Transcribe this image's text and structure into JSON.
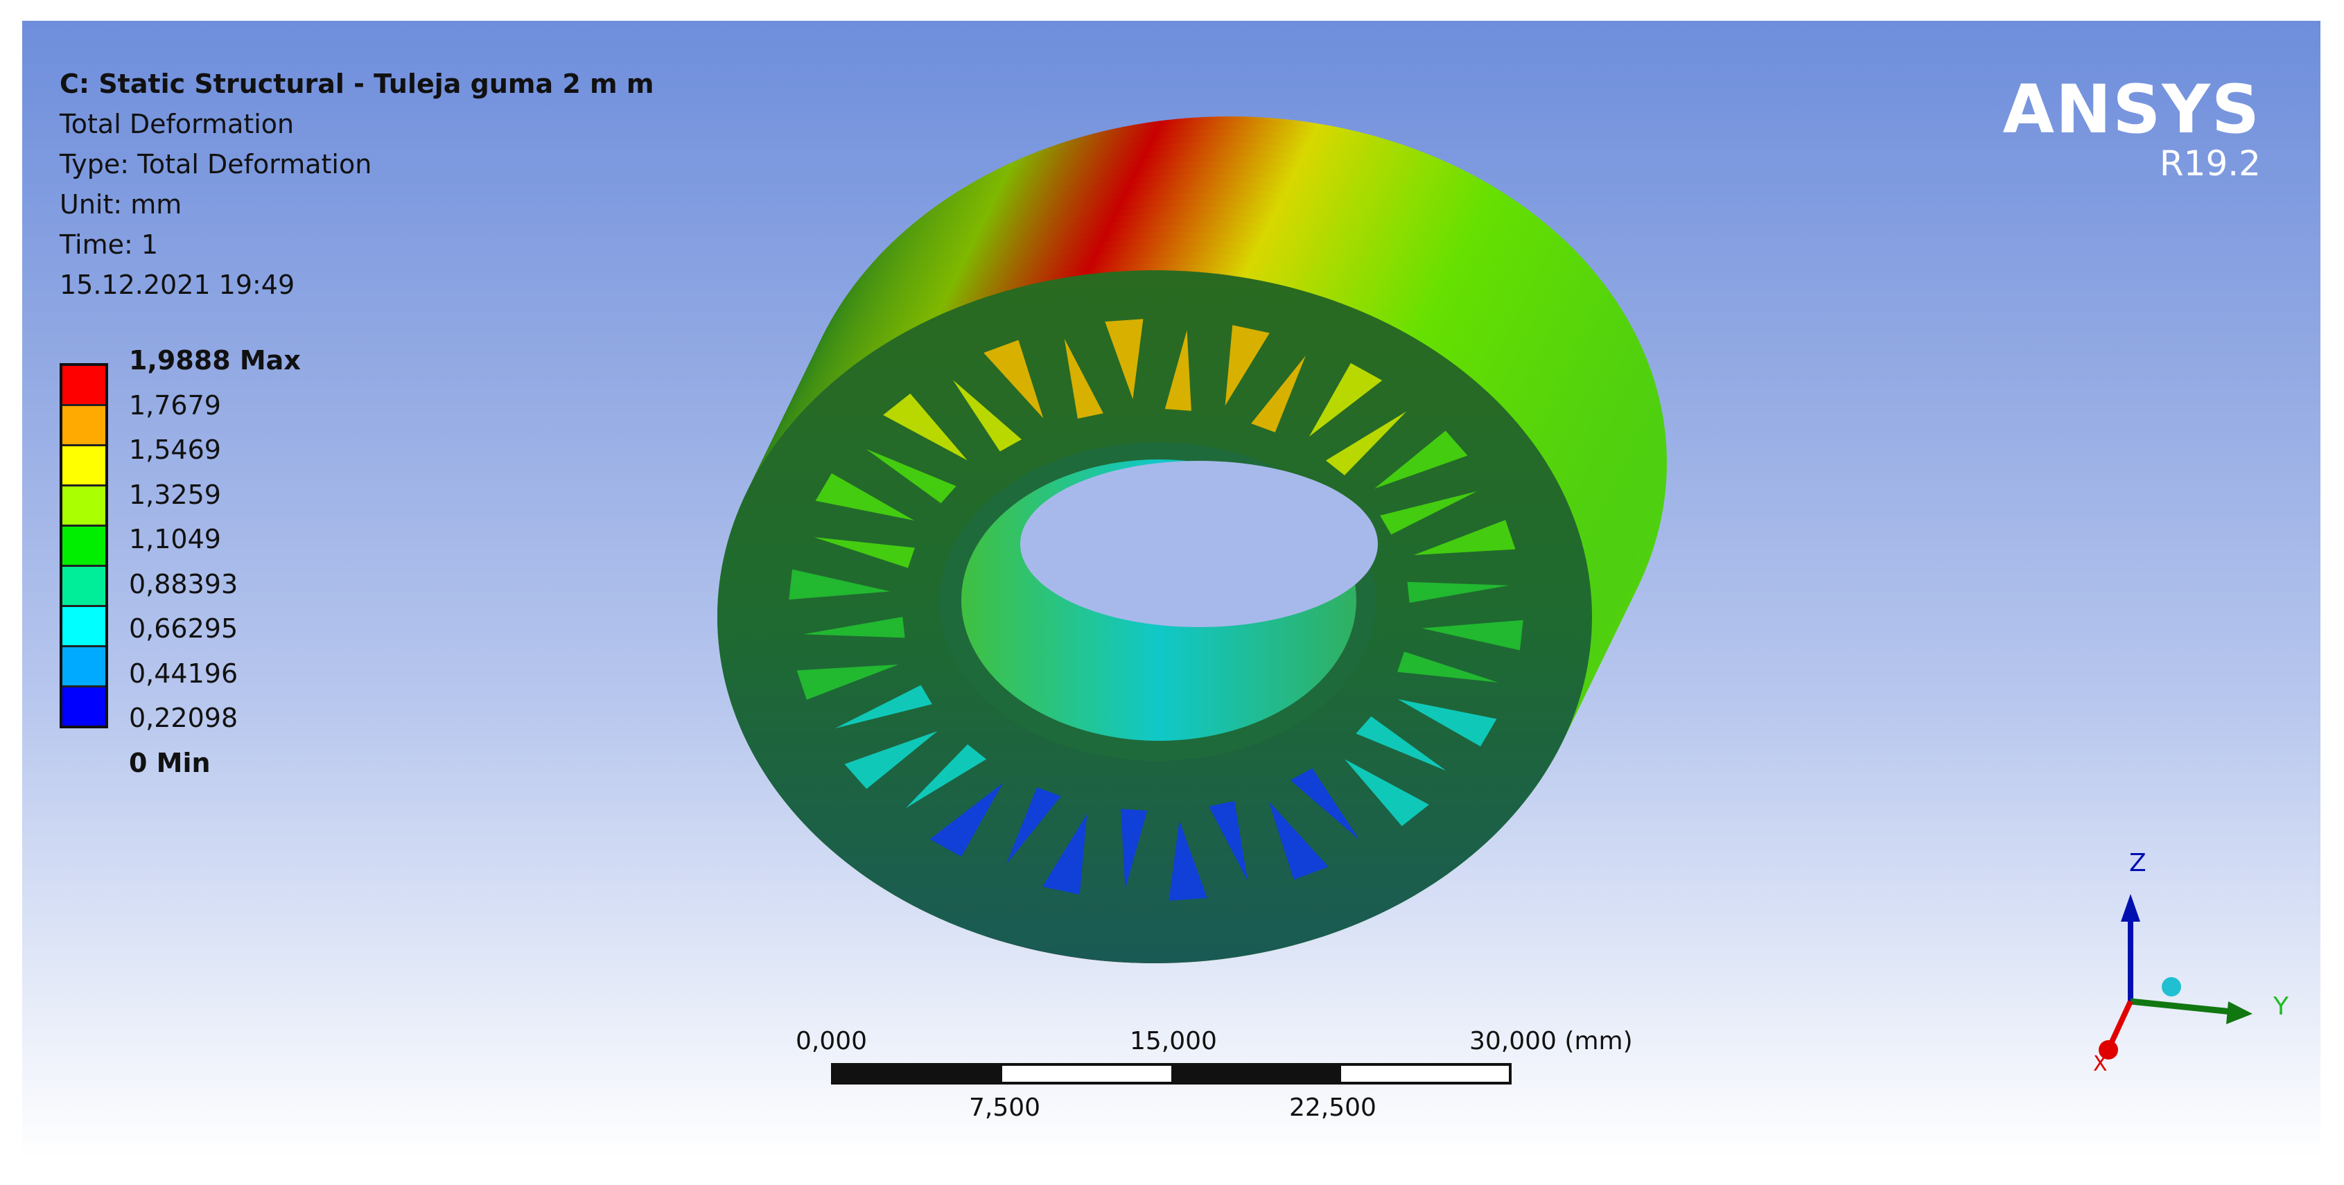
{
  "info": {
    "title": "C: Static Structural - Tuleja guma 2 m m",
    "result": "Total Deformation",
    "type": "Type: Total Deformation",
    "unit": "Unit: mm",
    "time": "Time: 1",
    "timestamp": "15.12.2021 19:49"
  },
  "legend": {
    "labels": [
      "1,9888 Max",
      "1,7679",
      "1,5469",
      "1,3259",
      "1,1049",
      "0,88393",
      "0,66295",
      "0,44196",
      "0,22098",
      "0 Min"
    ],
    "colors": [
      "#ff0000",
      "#ffaa00",
      "#ffff00",
      "#aaff00",
      "#00ee00",
      "#00ee99",
      "#00ffff",
      "#00aaff",
      "#0000ff"
    ]
  },
  "logo": {
    "name": "ANSYS",
    "version": "R19.2"
  },
  "scale_bar": {
    "top_labels": [
      "0,000",
      "15,000",
      "30,000 (mm)"
    ],
    "bottom_labels": [
      "7,500",
      "22,500"
    ]
  },
  "triad": {
    "x": "X",
    "y": "Y",
    "z": "Z"
  }
}
